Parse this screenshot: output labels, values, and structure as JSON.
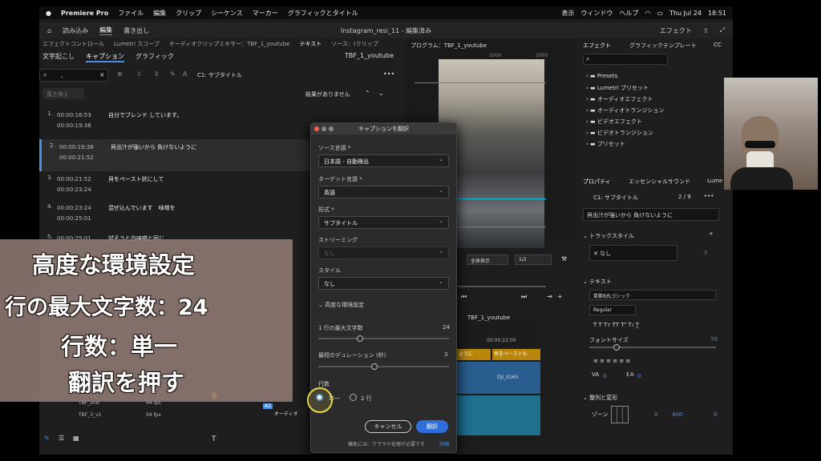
{
  "menubar": {
    "app": "Premiere Pro",
    "items": [
      "ファイル",
      "編集",
      "クリップ",
      "シーケンス",
      "マーカー",
      "グラフィックとタイトル",
      "表示",
      "ウィンドウ",
      "ヘルプ"
    ],
    "date": "Thu Jul 24",
    "time": "18:51"
  },
  "header": {
    "items": [
      "読み込み",
      "編集",
      "書き出し"
    ],
    "title": "Instagram_resi_11 - 編集済み",
    "workspace": "エフェクト"
  },
  "left_panel": {
    "tabs": [
      "エフェクトコントロール",
      "Lumetri スコープ",
      "オーディオクリップミキサー：TBF_1_youtube",
      "テキスト",
      "ソース：(クリップ"
    ],
    "subtabs": [
      "文字起こし",
      "キャプション",
      "グラフィック"
    ],
    "sequence": "TBF_1_youtube",
    "search_value": "、",
    "style": "C1: サブタイトル",
    "replace": "置き換え",
    "no_results": "結果がありません",
    "captions": [
      {
        "n": "1.",
        "in": "00:00:16:53",
        "out": "00:00:19:38",
        "text": "自分でブレンド しています。"
      },
      {
        "n": "2.",
        "in": "00:00:19:38",
        "out": "00:00:21:52",
        "text": "貝出汁が強いから 負けないように"
      },
      {
        "n": "3.",
        "in": "00:00:21:52",
        "out": "00:00:23:24",
        "text": "貝をペースト状にして"
      },
      {
        "n": "4.",
        "in": "00:00:23:24",
        "out": "00:00:25:01",
        "text": "混ぜ込んでいます　味噌を"
      },
      {
        "n": "5.",
        "in": "00:00:25:01",
        "out": "",
        "text": "試そうと白味噌と同じ"
      }
    ]
  },
  "overlay": {
    "lines": [
      "高度な環境設定",
      "行の最大文字数：24",
      "行数：単一",
      "翻訳を押す"
    ]
  },
  "program": {
    "title": "プログラム：TBF_1_youtube",
    "ruler": [
      "1000",
      "2000"
    ],
    "fit": "全体表示",
    "res": "1/2",
    "tc": "00:00:22:00"
  },
  "dialog": {
    "title": "キャプションを翻訳",
    "source_label": "ソース言語 *",
    "source_value": "日本語 - 自動検出",
    "target_label": "ターゲット言語 *",
    "target_value": "英語",
    "format_label": "形式 *",
    "format_value": "サブタイトル",
    "streaming_label": "ストリーミング",
    "streaming_value": "なし",
    "style_label": "スタイル",
    "style_value": "なし",
    "advanced": "高度な環境設定",
    "max_chars_label": "1 行の最大文字数",
    "max_chars_value": "24",
    "min_duration_label": "最短のデュレーション (秒)",
    "min_duration_value": "3",
    "lines_label": "行数",
    "single": "単一",
    "double": "2 行",
    "cancel": "キャンセル",
    "translate": "翻訳",
    "note": "機能には、クラウド処理が必要です",
    "details": "詳細"
  },
  "effects": {
    "title": "エフェクト",
    "tab2": "グラフィックテンプレート",
    "tab3": "CC",
    "items": [
      "Presets",
      "Lumetri プリセット",
      "オーディオエフェクト",
      "オーディオトランジション",
      "ビデオエフェクト",
      "ビデオトランジション",
      "プリセット"
    ]
  },
  "properties": {
    "title": "プロパティ",
    "tab2": "エッセンシャルサウンド",
    "tab3": "Lume",
    "clip": "C1: サブタイトル",
    "count": "2 / 9",
    "caption_text": "貝出汁が強いから 負けないように",
    "track_style": "トラックスタイル",
    "none": "なし",
    "none_num": "0",
    "text_label": "テキスト",
    "font": "筑紫B丸ゴシック",
    "weight": "Regular",
    "font_size_label": "フォントサイズ",
    "font_size": "70",
    "tracking": "0",
    "leading": "0",
    "transform_label": "整列と変形",
    "zone": "ゾーン",
    "zone_x": "0",
    "zone_y": "400",
    "zone_z": "0"
  },
  "project": {
    "items": [
      {
        "name": "TBF_2nd",
        "fps": "94 fps"
      },
      {
        "name": "TBF_3_v1",
        "fps": "94 fps"
      }
    ]
  },
  "timeline": {
    "tab": "TBF_1_youtube",
    "tc": "00:00:22:00",
    "clip1": "ように",
    "clip2": "貝をペーストも",
    "clip3": "DJI_0165",
    "audio": "オーディオ",
    "track": "A1"
  },
  "colors": {
    "accent": "#4a8fe7",
    "overlay": "#917b75"
  }
}
